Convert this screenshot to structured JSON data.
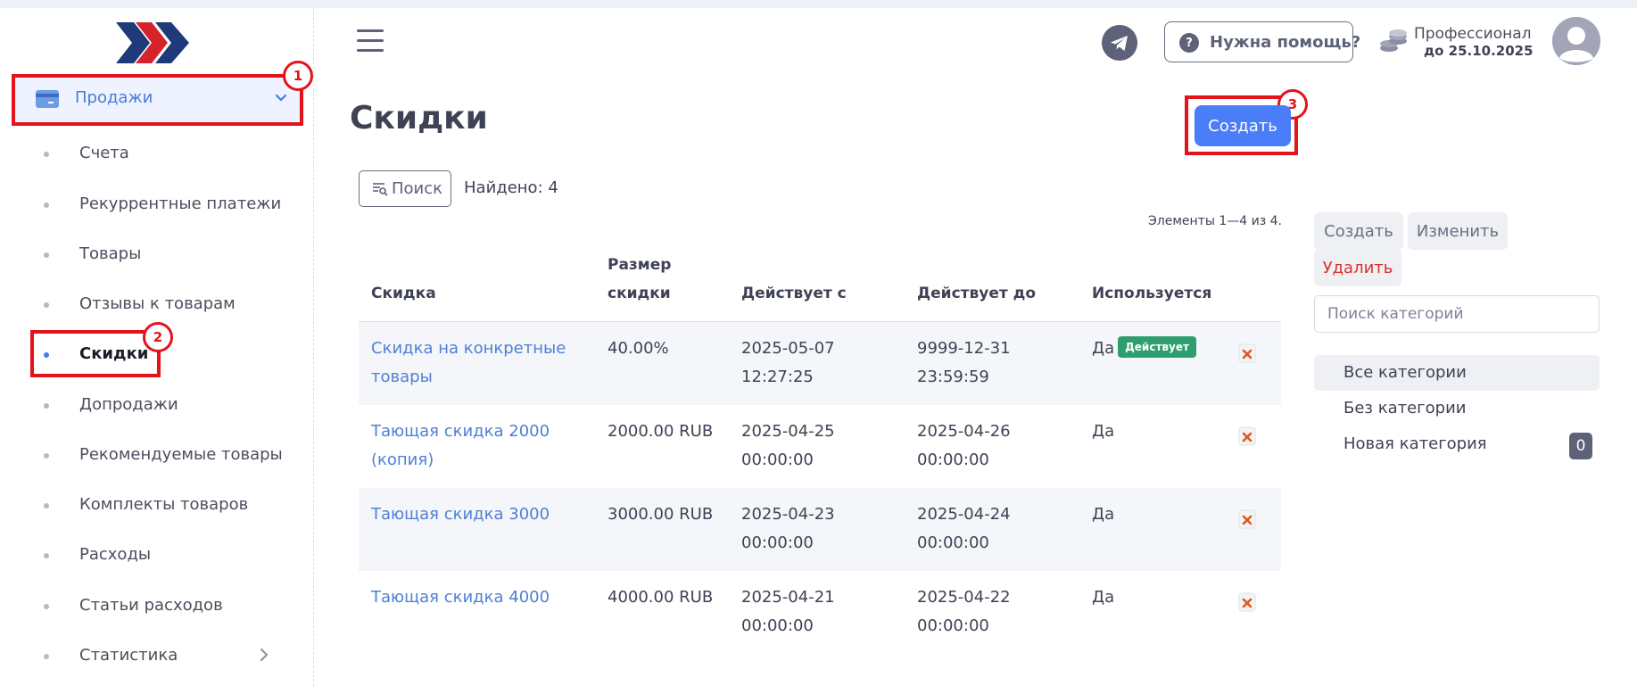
{
  "sidebar": {
    "parent": {
      "label": "Продажи",
      "icon": "credit-card-icon"
    },
    "items": [
      {
        "label": "Счета"
      },
      {
        "label": "Рекуррентные платежи"
      },
      {
        "label": "Товары"
      },
      {
        "label": "Отзывы к товарам"
      },
      {
        "label": "Скидки",
        "active": true
      },
      {
        "label": "Допродажи"
      },
      {
        "label": "Рекомендуемые товары"
      },
      {
        "label": "Комплекты товаров"
      },
      {
        "label": "Расходы"
      },
      {
        "label": "Статьи расходов"
      },
      {
        "label": "Статистика",
        "has_submenu": true
      }
    ]
  },
  "header": {
    "help_label": "Нужна помощь?",
    "plan_name": "Профессионал",
    "plan_until": "до 25.10.2025"
  },
  "annotations": {
    "m1": "1",
    "m2": "2",
    "m3": "3",
    "color": "#e3131b"
  },
  "page": {
    "title": "Скидки",
    "create_label": "Создать",
    "search_label": "Поиск",
    "found_text": "Найдено: 4",
    "elements_text": "Элементы 1—4 из 4."
  },
  "table": {
    "headers": {
      "discount": "Скидка",
      "size_line1": "Размер",
      "size_line2": "скидки",
      "from": "Действует с",
      "to": "Действует до",
      "used": "Используется"
    },
    "rows": [
      {
        "name_l1": "Скидка на конкретные",
        "name_l2": "товары",
        "size": "40.00%",
        "from_date": "2025-05-07",
        "from_time": "12:27:25",
        "to_date": "9999-12-31",
        "to_time": "23:59:59",
        "used": "Да",
        "badge": "Действует"
      },
      {
        "name_l1": "Тающая скидка 2000",
        "name_l2": "(копия)",
        "size": "2000.00 RUB",
        "from_date": "2025-04-25",
        "from_time": "00:00:00",
        "to_date": "2025-04-26",
        "to_time": "00:00:00",
        "used": "Да"
      },
      {
        "name_l1": "Тающая скидка 3000",
        "name_l2": "",
        "size": "3000.00 RUB",
        "from_date": "2025-04-23",
        "from_time": "00:00:00",
        "to_date": "2025-04-24",
        "to_time": "00:00:00",
        "used": "Да"
      },
      {
        "name_l1": "Тающая скидка 4000",
        "name_l2": "",
        "size": "4000.00 RUB",
        "from_date": "2025-04-21",
        "from_time": "00:00:00",
        "to_date": "2025-04-22",
        "to_time": "00:00:00",
        "used": "Да"
      }
    ]
  },
  "categories": {
    "create_label": "Создать",
    "edit_label": "Изменить",
    "delete_label": "Удалить",
    "search_placeholder": "Поиск категорий",
    "items": [
      {
        "label": "Все категории",
        "active": true
      },
      {
        "label": "Без категории"
      },
      {
        "label": "Новая категория",
        "count": "0"
      }
    ]
  },
  "colors": {
    "accent": "#4a7ef8",
    "link": "#4f7fd6",
    "badge": "#2f9e6e",
    "danger": "#d9312f"
  }
}
